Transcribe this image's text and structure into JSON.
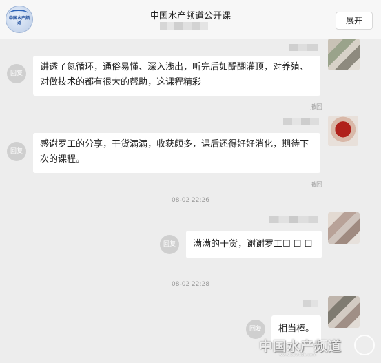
{
  "header": {
    "title": "中国水产频道公开课",
    "expand_label": "展开",
    "logo_text": "中国水产频道"
  },
  "labels": {
    "reply": "回复",
    "withdraw": "撤回"
  },
  "messages": [
    {
      "text_line1": "讲透了氮循环，通俗易懂、深入浅出，听完后如醍醐灌顶，对养殖、",
      "text_line2": "对做技术的都有很大的帮助，这课程精彩"
    },
    {
      "text_line1": "感谢罗工的分享，干货满满，收获颇多，课后还得好好消化，期待下",
      "text_line2": "次的课程。"
    },
    {
      "text": "满满的干货，谢谢罗工☐ ☐ ☐"
    },
    {
      "text": "相当棒。"
    }
  ],
  "timestamps": [
    "08-02 22:26",
    "08-02 22:28"
  ],
  "watermark": {
    "text": "中国水产频道",
    "url": "www.bbwfish.com"
  },
  "colors": {
    "background": "#ededed",
    "bubble": "#ffffff",
    "reply_icon": "#cfcfcf"
  }
}
